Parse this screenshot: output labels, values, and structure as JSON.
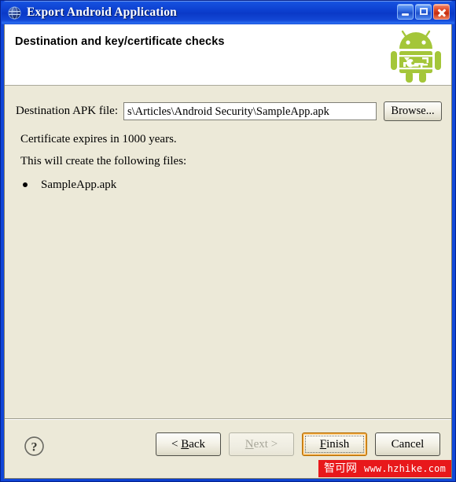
{
  "window": {
    "title": "Export Android Application",
    "icon": "globe-icon",
    "controls": {
      "minimize": "Minimize",
      "maximize": "Maximize",
      "close": "Close"
    },
    "frame_color": "#0a3fd4",
    "client_bg": "#ece9d8"
  },
  "wizard": {
    "header_title": "Destination and key/certificate checks",
    "banner_icon": "android-robot-key-icon",
    "android_green": "#a4c639"
  },
  "form": {
    "destination_label": "Destination APK file:",
    "destination_value": "s\\Articles\\Android Security\\SampleApp.apk",
    "destination_placeholder": "Destination APK file",
    "browse_label": "Browse..."
  },
  "messages": {
    "certificate_expiry": "Certificate expires in 1000 years.",
    "files_intro": "This will create the following files:",
    "files": [
      "SampleApp.apk"
    ]
  },
  "footer": {
    "help_icon": "question-mark-icon",
    "buttons": [
      {
        "name": "back",
        "prefix": "< ",
        "mnemonic": "B",
        "suffix": "ack",
        "state": "enabled"
      },
      {
        "name": "next",
        "prefix": "",
        "mnemonic": "N",
        "suffix": "ext >",
        "state": "disabled"
      },
      {
        "name": "finish",
        "prefix": "",
        "mnemonic": "F",
        "suffix": "inish",
        "state": "default"
      },
      {
        "name": "cancel",
        "prefix": "",
        "mnemonic": "",
        "suffix": "Cancel",
        "state": "enabled"
      }
    ],
    "back_label": "< Back",
    "next_label": "Next >",
    "finish_label": "Finish",
    "cancel_label": "Cancel"
  },
  "watermark": {
    "cn_text": "智可网",
    "url_text": "www.hzhike.com",
    "bg_color": "#e8181b"
  }
}
